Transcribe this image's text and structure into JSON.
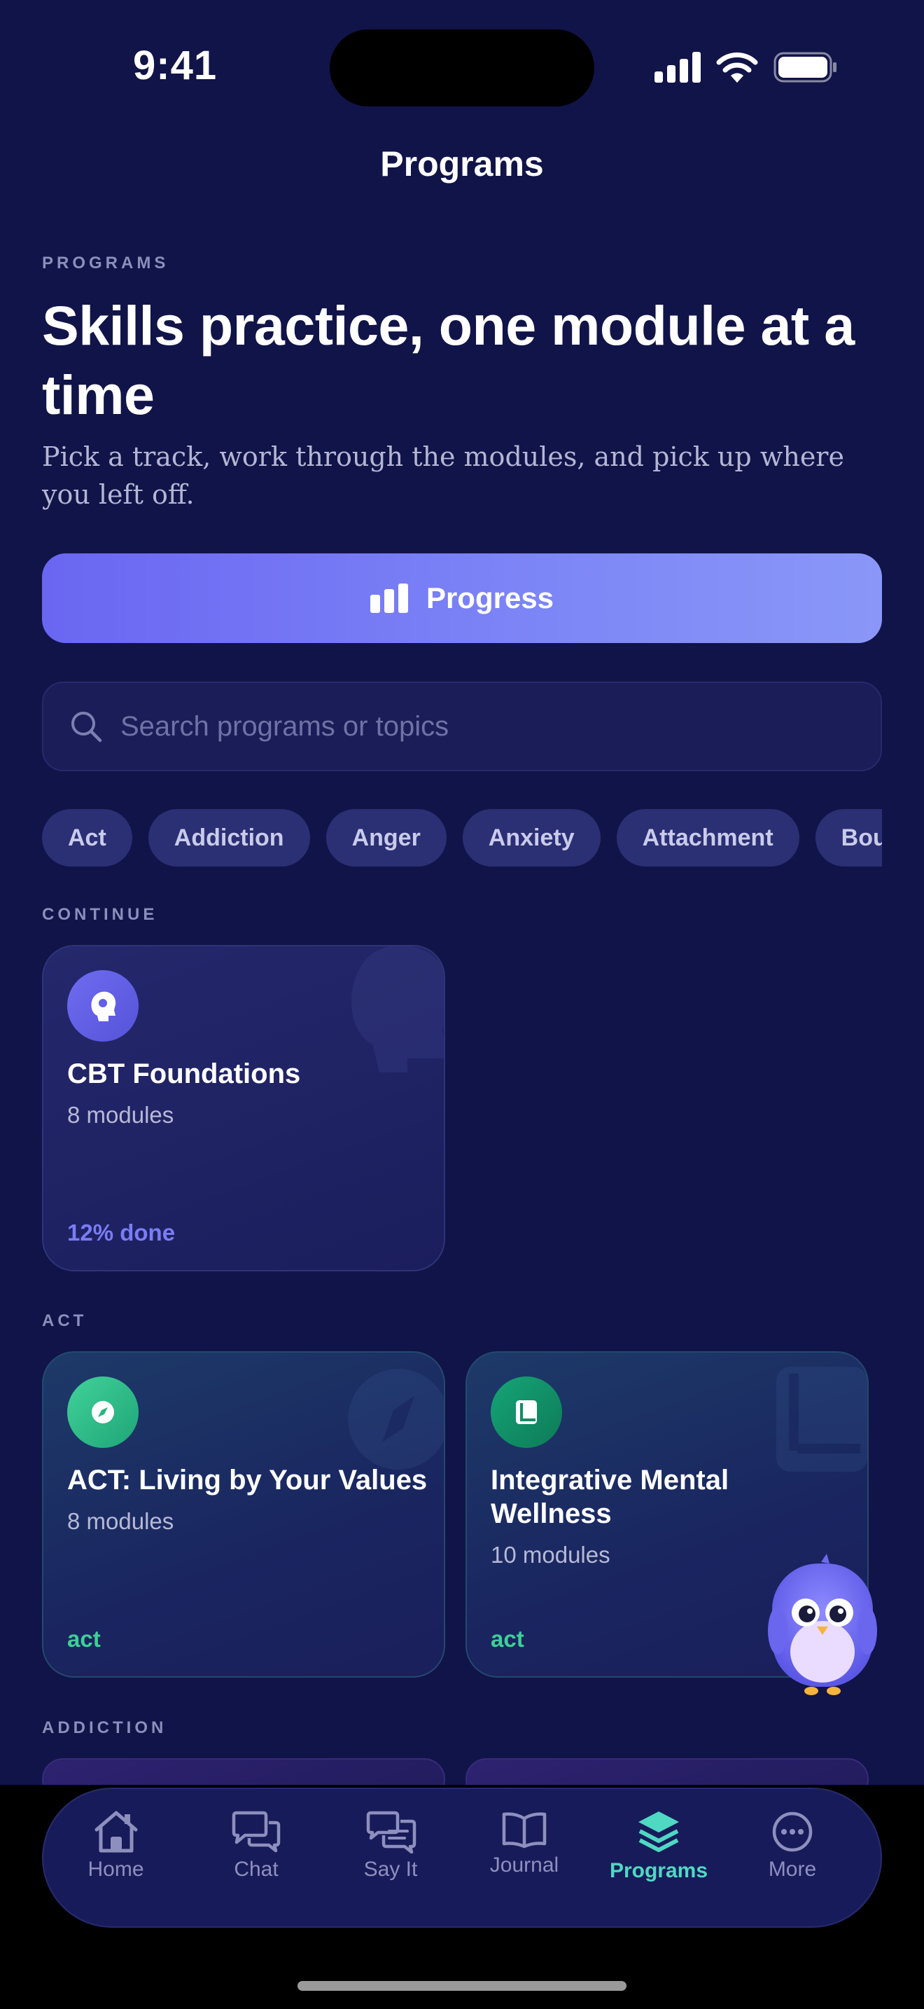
{
  "status_bar": {
    "time": "9:41"
  },
  "nav": {
    "title": "Programs"
  },
  "hero": {
    "eyebrow": "PROGRAMS",
    "headline": "Skills practice, one module at a time",
    "subtitle": "Pick a track, work through the modules, and pick up where you left off."
  },
  "progress_button": {
    "label": "Progress"
  },
  "search": {
    "placeholder": "Search programs or topics"
  },
  "filters": [
    "Act",
    "Addiction",
    "Anger",
    "Anxiety",
    "Attachment",
    "Boundaries"
  ],
  "sections": {
    "continue": {
      "label": "CONTINUE",
      "card": {
        "title": "CBT Foundations",
        "subtitle": "8 modules",
        "tag": "12% done",
        "icon": "head-brain-icon",
        "progress": 0.12
      }
    },
    "act": {
      "label": "ACT",
      "cards": [
        {
          "title": "ACT: Living by Your Values",
          "subtitle": "8 modules",
          "tag": "act",
          "icon": "compass-icon"
        },
        {
          "title": "Integrative Mental Wellness",
          "subtitle": "10 modules",
          "tag": "act",
          "icon": "book-icon"
        }
      ]
    },
    "addiction": {
      "label": "ADDICTION"
    }
  },
  "tabbar": {
    "items": [
      {
        "label": "Home",
        "icon": "home-icon"
      },
      {
        "label": "Chat",
        "icon": "chat-icon"
      },
      {
        "label": "Say It",
        "icon": "say-it-icon"
      },
      {
        "label": "Journal",
        "icon": "journal-icon"
      },
      {
        "label": "Programs",
        "icon": "programs-layers-icon",
        "active": true
      },
      {
        "label": "More",
        "icon": "more-icon"
      }
    ]
  },
  "colors": {
    "accent": "#6c6cf3",
    "active_tab": "#4fd9c3",
    "background": "#111448",
    "act_tag": "#3ecf97",
    "progress_tag": "#7b7cf5"
  }
}
